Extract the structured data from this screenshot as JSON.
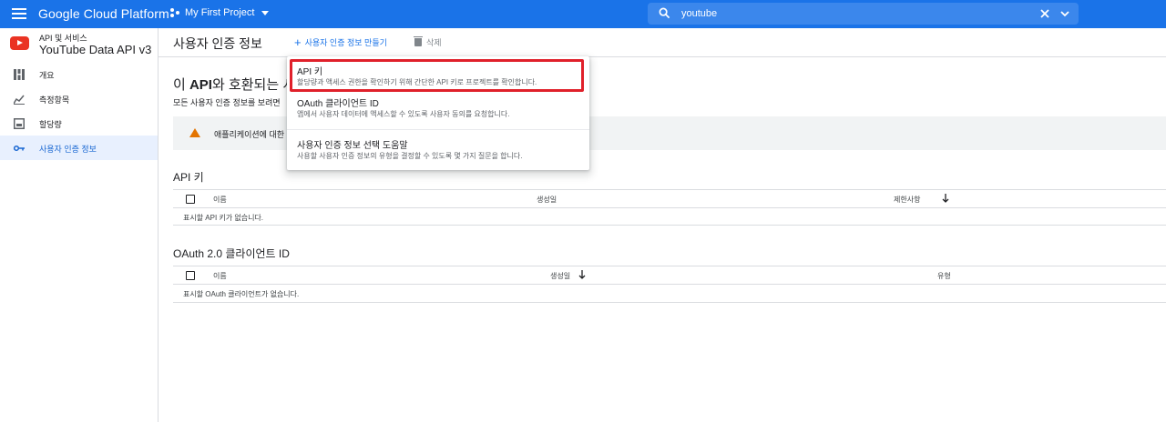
{
  "topbar": {
    "brand": "Google Cloud Platform",
    "project": "My First Project",
    "search_value": "youtube"
  },
  "sidebar": {
    "api_sub": "API 및 서비스",
    "api_title": "YouTube Data API v3",
    "items": [
      {
        "label": "개요",
        "icon": "dashboard-icon"
      },
      {
        "label": "측정항목",
        "icon": "metrics-icon"
      },
      {
        "label": "할당량",
        "icon": "quota-icon"
      },
      {
        "label": "사용자 인증 정보",
        "icon": "key-icon",
        "active": true
      }
    ]
  },
  "header": {
    "title": "사용자 인증 정보",
    "create_label": "사용자 인증 정보 만들기",
    "delete_label": "삭제"
  },
  "main": {
    "heading_prefix": "이 ",
    "heading_bold": "API",
    "heading_rest": "와 호환되는 시",
    "desc": "모든 사용자 인증 정보를 보려면",
    "warning": "애플리케이션에 대한"
  },
  "api_keys": {
    "title": "API 키",
    "columns": [
      "이름",
      "생성일",
      "제한사항"
    ],
    "empty": "표시할 API 키가 없습니다."
  },
  "oauth": {
    "title": "OAuth 2.0 클라이언트 ID",
    "columns": [
      "이름",
      "생성일",
      "유형"
    ],
    "empty": "표시할 OAuth 클라이언트가 없습니다."
  },
  "dropdown": {
    "items": [
      {
        "title": "API 키",
        "desc": "할당량과 액세스 권한을 확인하기 위해 간단한 API 키로 프로젝트를 확인합니다."
      },
      {
        "title": "OAuth 클라이언트 ID",
        "desc": "앱에서 사용자 데이터에 액세스할 수 있도록 사용자 동의를 요청합니다."
      },
      {
        "title": "사용자 인증 정보 선택 도움말",
        "desc": "사용할 사용자 인증 정보의 유형을 결정할 수 있도록 몇 가지 질문을 합니다."
      }
    ]
  },
  "colors": {
    "accent": "#1a73e8",
    "highlight": "#e0202a",
    "warning": "#e37400"
  }
}
